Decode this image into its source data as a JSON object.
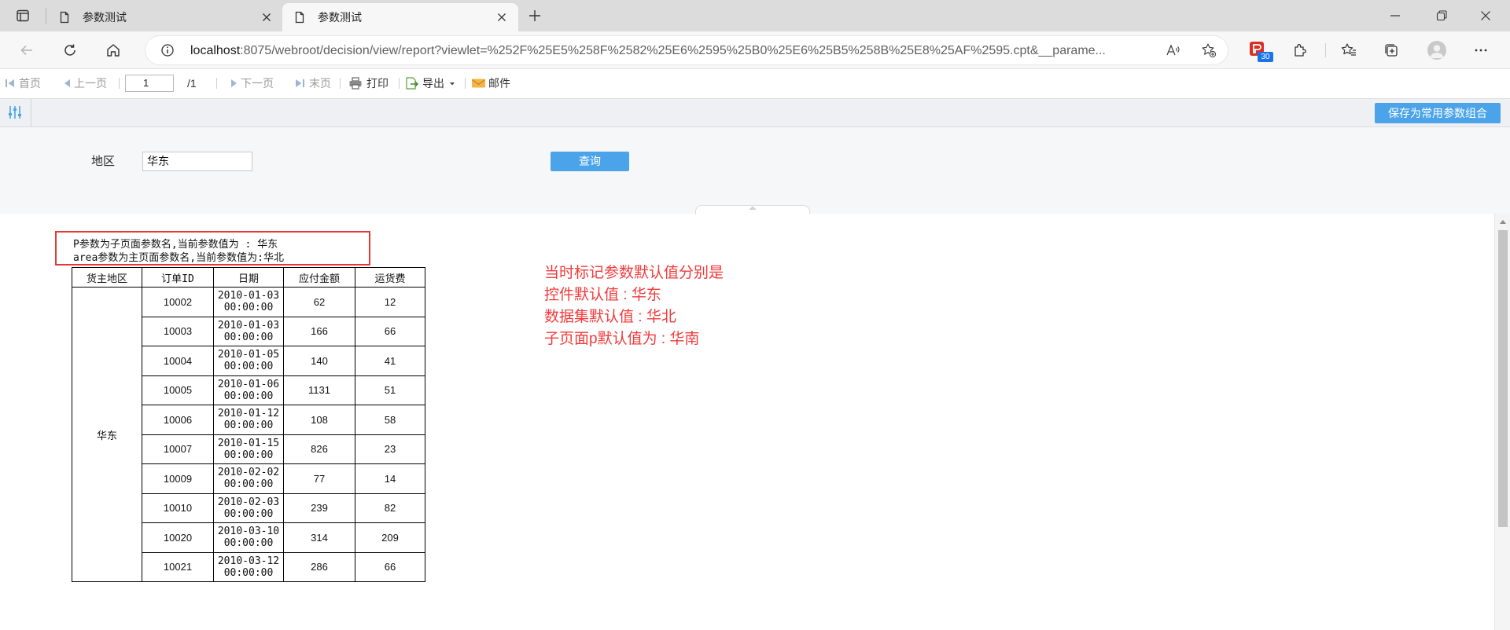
{
  "browser": {
    "tabs": [
      {
        "title": "参数测试"
      },
      {
        "title": "参数测试"
      }
    ],
    "url_host": "localhost",
    "url_rest": ":8075/webroot/decision/view/report?viewlet=%252F%25E5%258F%2582%25E6%2595%25B0%25E6%25B5%258B%25E8%25AF%2595.cpt&__parame...",
    "extension_badge": "30",
    "icons": [
      "tab-actions-icon",
      "page-icon",
      "close-icon",
      "new-tab-icon",
      "minimize-icon",
      "restore-icon",
      "back-icon",
      "refresh-icon",
      "home-icon",
      "info-icon",
      "read-aloud-icon",
      "add-favorite-icon",
      "extension-icon",
      "puzzle-icon",
      "favorites-icon",
      "collections-icon",
      "avatar",
      "more-icon"
    ]
  },
  "toolbar": {
    "first": "首页",
    "prev": "上一页",
    "page_value": "1",
    "page_total": "/1",
    "next": "下一页",
    "last": "末页",
    "print": "打印",
    "export": "导出",
    "mail": "邮件"
  },
  "params": {
    "save_button": "保存为常用参数组合",
    "area_label": "地区",
    "area_value": "华东",
    "query_button": "查询"
  },
  "report": {
    "line1": "P参数为子页面参数名,当前参数值为 : 华东",
    "line2": "area参数为主页面参数名,当前参数值为:华北",
    "headers": [
      "货主地区",
      "订单ID",
      "日期",
      "应付金额",
      "运货费"
    ],
    "region": "华东",
    "rows": [
      {
        "id": "10002",
        "date": "2010-01-03 00:00:00",
        "amount": "62",
        "freight": "12"
      },
      {
        "id": "10003",
        "date": "2010-01-03 00:00:00",
        "amount": "166",
        "freight": "66"
      },
      {
        "id": "10004",
        "date": "2010-01-05 00:00:00",
        "amount": "140",
        "freight": "41"
      },
      {
        "id": "10005",
        "date": "2010-01-06 00:00:00",
        "amount": "1131",
        "freight": "51"
      },
      {
        "id": "10006",
        "date": "2010-01-12 00:00:00",
        "amount": "108",
        "freight": "58"
      },
      {
        "id": "10007",
        "date": "2010-01-15 00:00:00",
        "amount": "826",
        "freight": "23"
      },
      {
        "id": "10009",
        "date": "2010-02-02 00:00:00",
        "amount": "77",
        "freight": "14"
      },
      {
        "id": "10010",
        "date": "2010-02-03 00:00:00",
        "amount": "239",
        "freight": "82"
      },
      {
        "id": "10020",
        "date": "2010-03-10 00:00:00",
        "amount": "314",
        "freight": "209"
      },
      {
        "id": "10021",
        "date": "2010-03-12 00:00:00",
        "amount": "286",
        "freight": "66"
      }
    ]
  },
  "annotations": [
    "当时标记参数默认值分别是",
    "控件默认值 : 华东",
    "数据集默认值 : 华北",
    "子页面p默认值为 : 华南"
  ],
  "colors": {
    "accent": "#4ba4ea",
    "annotation": "#f23a3a",
    "highlight_box": "#e53935"
  }
}
